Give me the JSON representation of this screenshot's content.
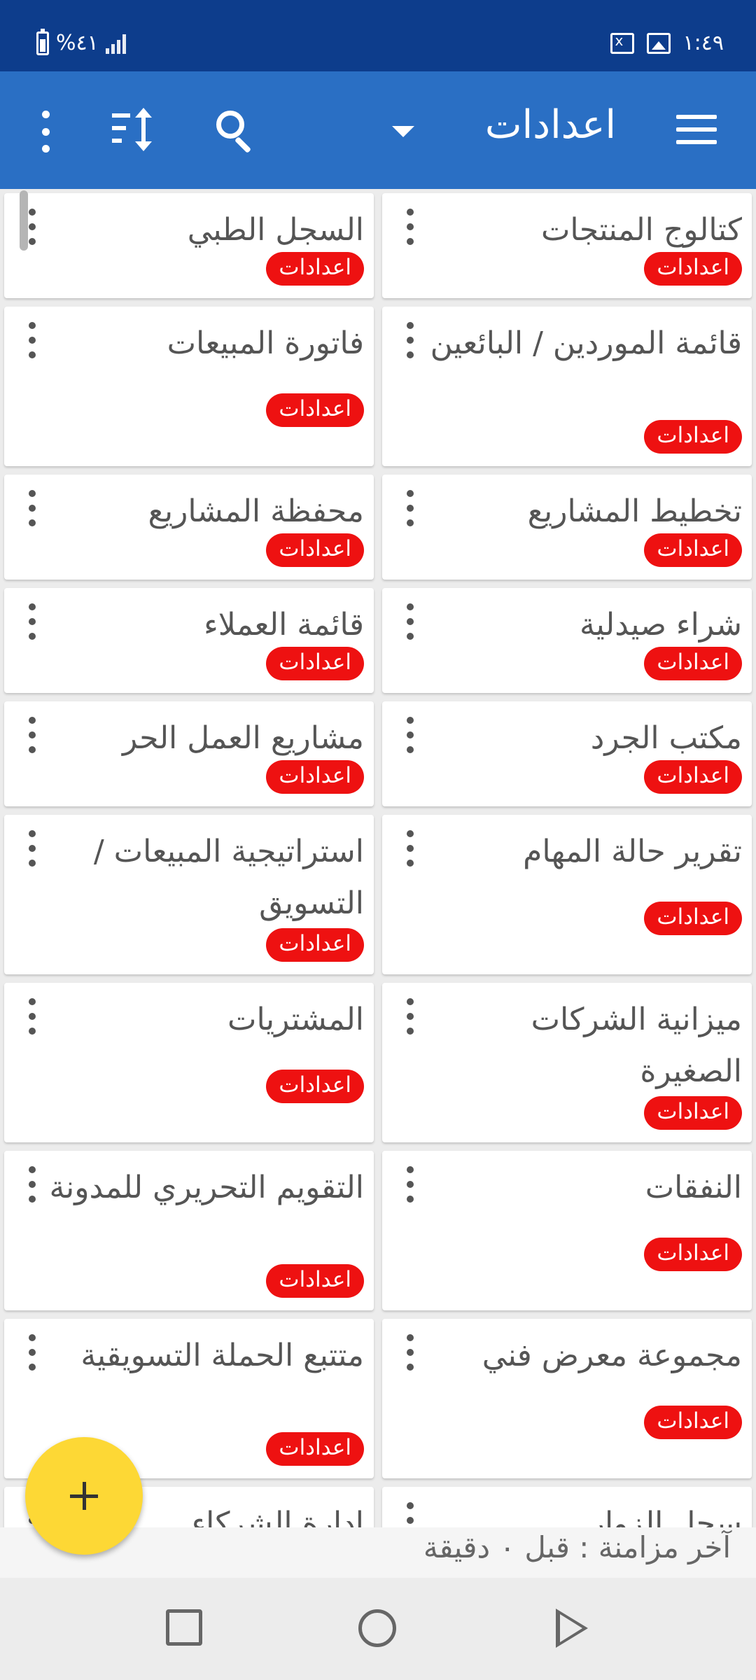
{
  "status_bar": {
    "time": "١:٤٩",
    "battery": "%٤١"
  },
  "app_bar": {
    "title": "اعدادات"
  },
  "badge_label": "اعدادات",
  "cards": [
    {
      "title": "كتالوج المنتجات",
      "badge": "اعدادات"
    },
    {
      "title": "السجل الطبي",
      "badge": "اعدادات"
    },
    {
      "title": "قائمة الموردين / البائعين",
      "badge": "اعدادات"
    },
    {
      "title": "فاتورة المبيعات",
      "badge": "اعدادات"
    },
    {
      "title": "تخطيط المشاريع",
      "badge": "اعدادات"
    },
    {
      "title": "محفظة المشاريع",
      "badge": "اعدادات"
    },
    {
      "title": "شراء صيدلية",
      "badge": "اعدادات"
    },
    {
      "title": "قائمة العملاء",
      "badge": "اعدادات"
    },
    {
      "title": "مكتب الجرد",
      "badge": "اعدادات"
    },
    {
      "title": "مشاريع العمل الحر",
      "badge": "اعدادات"
    },
    {
      "title": "تقرير حالة المهام",
      "badge": "اعدادات"
    },
    {
      "title": "استراتيجية المبيعات / التسويق",
      "badge": "اعدادات"
    },
    {
      "title": "ميزانية الشركات الصغيرة",
      "badge": "اعدادات"
    },
    {
      "title": "المشتريات",
      "badge": "اعدادات"
    },
    {
      "title": "النفقات",
      "badge": "اعدادات"
    },
    {
      "title": "التقويم التحريري للمدونة",
      "badge": "اعدادات"
    },
    {
      "title": "مجموعة معرض فني",
      "badge": "اعدادات"
    },
    {
      "title": "متتبع الحملة التسويقية",
      "badge": "اعدادات"
    },
    {
      "title": "سجل الزوار",
      "badge": ""
    },
    {
      "title": "ادارة الشركاء",
      "badge": ""
    }
  ],
  "sync": {
    "text": "آخر مزامنة  :  قبل ٠ دقيقة"
  },
  "fab": {
    "icon": "plus-icon"
  },
  "icons": {
    "menu": "hamburger-icon",
    "search": "search-icon",
    "sort": "sort-icon",
    "more": "more-vert-icon"
  },
  "colors": {
    "status_bar": "#0d3d8c",
    "app_bar": "#2a6fc4",
    "badge": "#ee1111",
    "fab": "#fdd835"
  }
}
